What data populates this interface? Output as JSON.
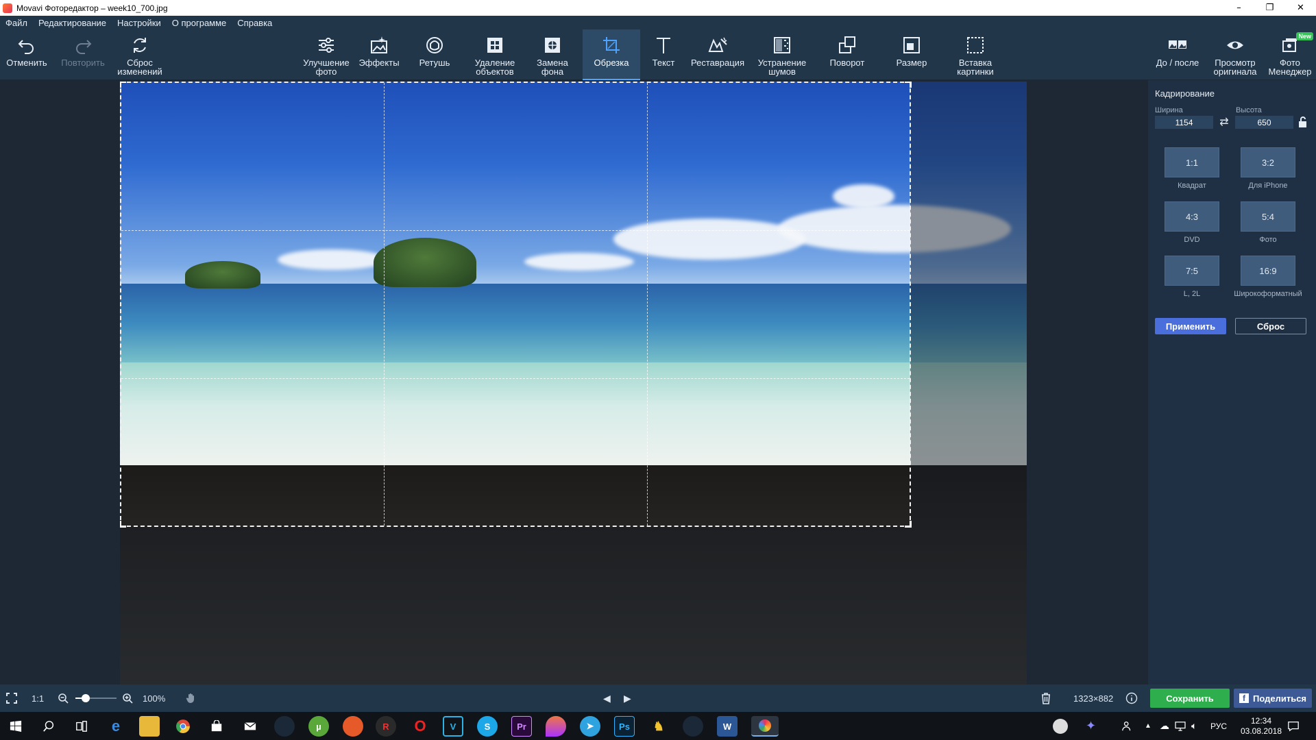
{
  "window": {
    "title": "Movavi Фоторедактор – week10_700.jpg",
    "minimize": "–",
    "maximize": "❐",
    "close": "✕"
  },
  "menu": [
    "Файл",
    "Редактирование",
    "Настройки",
    "О программе",
    "Справка"
  ],
  "toolbar": {
    "undo": "Отменить",
    "redo": "Повторить",
    "reset": "Сброс\nизменений",
    "enhance": "Улучшение\nфото",
    "effects": "Эффекты",
    "retouch": "Ретушь",
    "remove_objects": "Удаление\nобъектов",
    "replace_bg": "Замена\nфона",
    "crop": "Обрезка",
    "text": "Текст",
    "restore": "Реставрация",
    "denoise": "Устранение\nшумов",
    "rotate": "Поворот",
    "resize": "Размер",
    "insert_picture": "Вставка\nкартинки",
    "before_after": "До / после",
    "view_original": "Просмотр\nоригинала",
    "photo_manager": "Фото\nМенеджер",
    "new_badge": "New"
  },
  "panel": {
    "title": "Кадрирование",
    "width_label": "Ширина",
    "height_label": "Высота",
    "width": "1154",
    "height": "650",
    "ratios": [
      {
        "ratio": "1:1",
        "label": "Квадрат"
      },
      {
        "ratio": "3:2",
        "label": "Для iPhone"
      },
      {
        "ratio": "4:3",
        "label": "DVD"
      },
      {
        "ratio": "5:4",
        "label": "Фото"
      },
      {
        "ratio": "7:5",
        "label": "L, 2L"
      },
      {
        "ratio": "16:9",
        "label": "Широкоформатный"
      }
    ],
    "apply": "Применить",
    "reset": "Сброс"
  },
  "status": {
    "one_to_one": "1:1",
    "zoom": "100%",
    "zoom_fraction": 0.25,
    "dimensions": "1323×882",
    "save": "Сохранить",
    "share": "Поделиться"
  },
  "taskbar": {
    "lang": "РУС",
    "time": "12:34",
    "date": "03.08.2018"
  },
  "colors": {
    "accent": "#4da3ff",
    "save": "#2fae4e",
    "apply": "#4a6fdc",
    "share": "#3d5a96"
  }
}
